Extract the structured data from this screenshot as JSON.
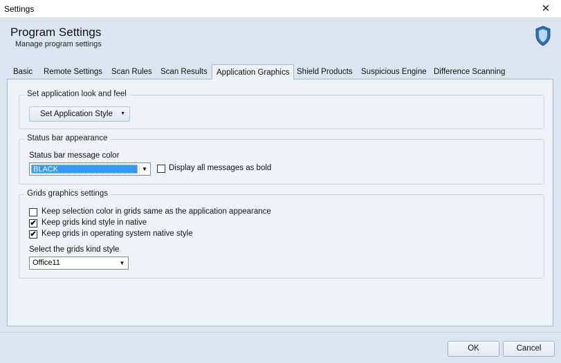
{
  "window": {
    "title": "Settings",
    "close_glyph": "✕"
  },
  "header": {
    "title": "Program Settings",
    "subtitle": "Manage program settings",
    "icon": "shield-icon"
  },
  "tabs": [
    {
      "label": "Basic"
    },
    {
      "label": "Remote Settings"
    },
    {
      "label": "Scan Rules"
    },
    {
      "label": "Scan Results"
    },
    {
      "label": "Application Graphics",
      "active": true
    },
    {
      "label": "Shield Products"
    },
    {
      "label": "Suspicious Engine"
    },
    {
      "label": "Difference Scanning"
    }
  ],
  "look": {
    "legend": "Set application look and feel",
    "button_label": "Set Application Style"
  },
  "status_bar": {
    "legend": "Status bar appearance",
    "color_label": "Status bar message color",
    "color_value": "BLACK",
    "bold_label": "Display all messages as bold",
    "bold_checked": false
  },
  "grids": {
    "legend": "Grids graphics settings",
    "options": [
      {
        "label": "Keep selection color in grids same as the application appearance",
        "checked": false
      },
      {
        "label": "Keep grids kind style in native",
        "checked": true
      },
      {
        "label": "Keep grids in operating system native style",
        "checked": true
      }
    ],
    "style_label": "Select the grids kind style",
    "style_value": "Office11"
  },
  "footer": {
    "ok": "OK",
    "cancel": "Cancel"
  },
  "colors": {
    "accent": "#3399ff",
    "background": "#dbe4ef",
    "panel": "#eef3f8"
  }
}
